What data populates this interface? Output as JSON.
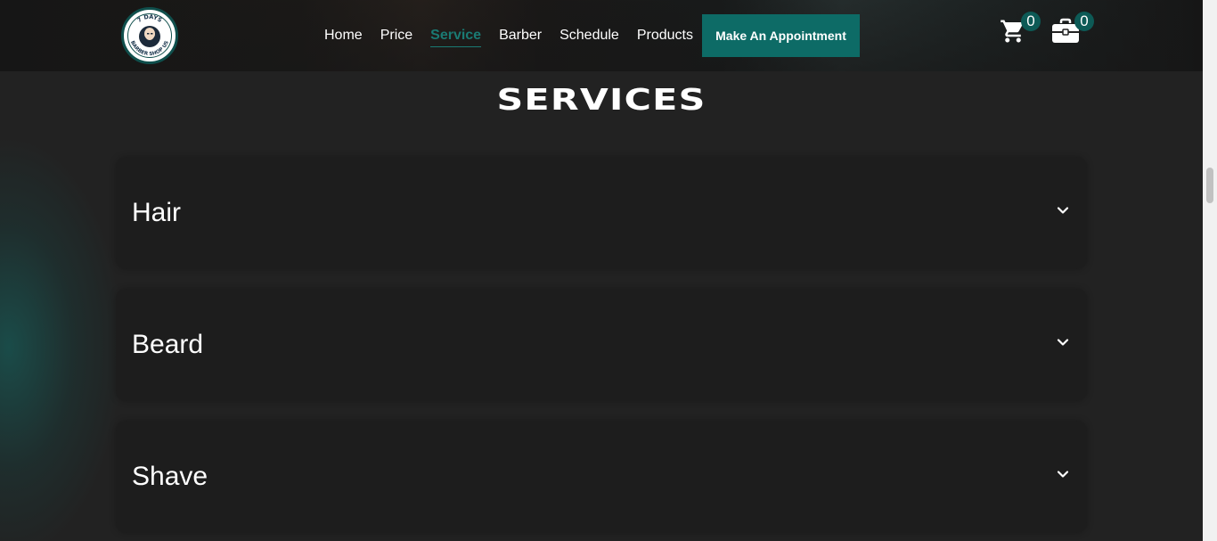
{
  "header": {
    "logo": {
      "top_text": "7 DAYS",
      "bottom_text": "BARBER SHOP US",
      "icon": "barber-portrait-icon"
    },
    "nav": [
      {
        "label": "Home",
        "active": false
      },
      {
        "label": "Price",
        "active": false
      },
      {
        "label": "Service",
        "active": true
      },
      {
        "label": "Barber",
        "active": false
      },
      {
        "label": "Schedule",
        "active": false
      },
      {
        "label": "Products",
        "active": false
      }
    ],
    "cta_label": "Make An Appointment",
    "cart": {
      "icon": "cart-icon",
      "count": "0"
    },
    "briefcase": {
      "icon": "briefcase-icon",
      "count": "0"
    }
  },
  "services": {
    "title": "SERVICES",
    "items": [
      {
        "label": "Hair",
        "icon": "chevron-down-icon"
      },
      {
        "label": "Beard",
        "icon": "chevron-down-icon"
      },
      {
        "label": "Shave",
        "icon": "chevron-down-icon"
      }
    ]
  },
  "colors": {
    "accent": "#0d6b66",
    "active_link": "#1a7a73",
    "background": "#222222",
    "card": "#1d1d1d"
  }
}
